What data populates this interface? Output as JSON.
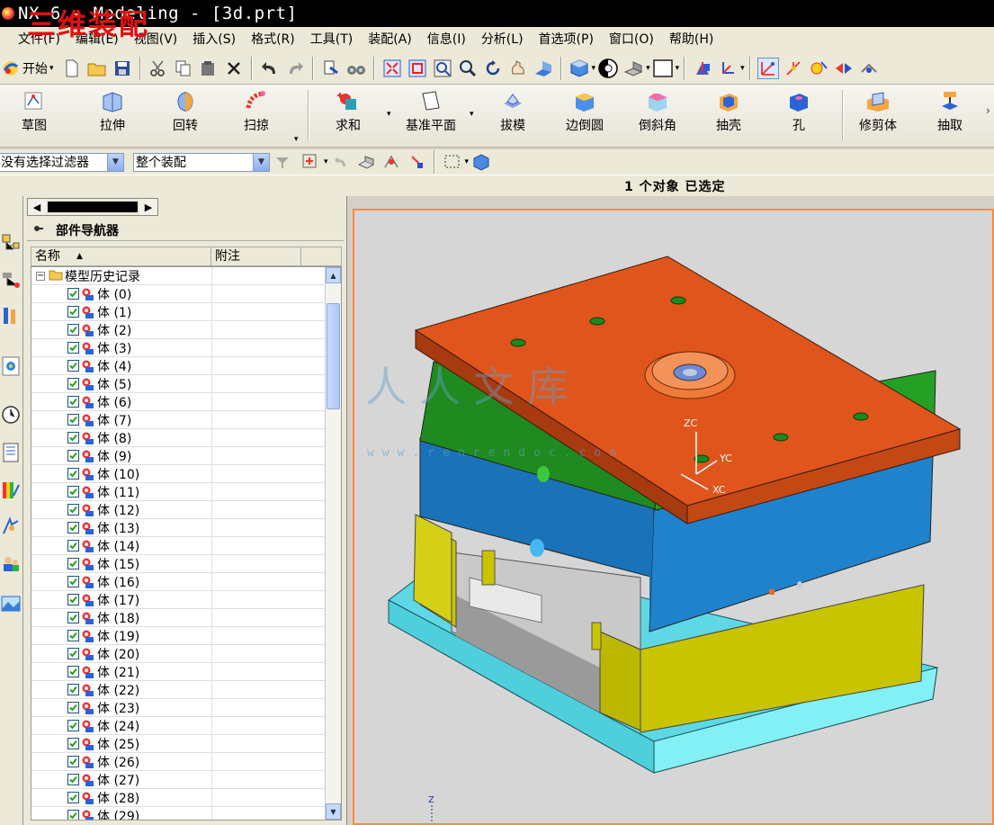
{
  "window": {
    "title": "NX 6 - Modeling - [3d.prt]",
    "overlay_label": "三维装配"
  },
  "menubar": {
    "items": [
      "文件(F)",
      "编辑(E)",
      "视图(V)",
      "插入(S)",
      "格式(R)",
      "工具(T)",
      "装配(A)",
      "信息(I)",
      "分析(L)",
      "首选项(P)",
      "窗口(O)",
      "帮助(H)"
    ]
  },
  "toolbar": {
    "start_label": "开始"
  },
  "feature_toolbar": {
    "sketch": "草图",
    "extrude": "拉伸",
    "revolve": "回转",
    "sweep": "扫掠",
    "unite": "求和",
    "datum_plane": "基准平面",
    "draft": "拔模",
    "edge_blend": "边倒圆",
    "chamfer": "倒斜角",
    "shell": "抽壳",
    "hole": "孔",
    "trim_body": "修剪体",
    "extract": "抽取"
  },
  "selection_bar": {
    "filter_value": "没有选择过滤器",
    "scope_value": "整个装配"
  },
  "status": {
    "text": "1 个对象 已选定"
  },
  "navigator": {
    "title": "部件导航器",
    "col_name": "名称",
    "col_note": "附注",
    "root_label": "模型历史记录",
    "bodies": [
      "体 (0)",
      "体 (1)",
      "体 (2)",
      "体 (3)",
      "体 (4)",
      "体 (5)",
      "体 (6)",
      "体 (7)",
      "体 (8)",
      "体 (9)",
      "体 (10)",
      "体 (11)",
      "体 (12)",
      "体 (13)",
      "体 (14)",
      "体 (15)",
      "体 (16)",
      "体 (17)",
      "体 (18)",
      "体 (19)",
      "体 (20)",
      "体 (21)",
      "体 (22)",
      "体 (23)",
      "体 (24)",
      "体 (25)",
      "体 (26)",
      "体 (27)",
      "体 (28)",
      "体 (29)"
    ]
  },
  "viewport": {
    "axis_labels": {
      "zc": "ZC",
      "yc": "YC",
      "xc": "XC",
      "z": "Z"
    },
    "watermark": "人人文库",
    "watermark_url": "www.renrendoc.com",
    "colors": {
      "top_plate": "#e0551c",
      "a_plate": "#1f8a1f",
      "b_plate": "#1a73b8",
      "spacer_block": "#c8c400",
      "bottom_plate": "#66e6ee",
      "highlight_border": "#ff8a3c"
    }
  }
}
